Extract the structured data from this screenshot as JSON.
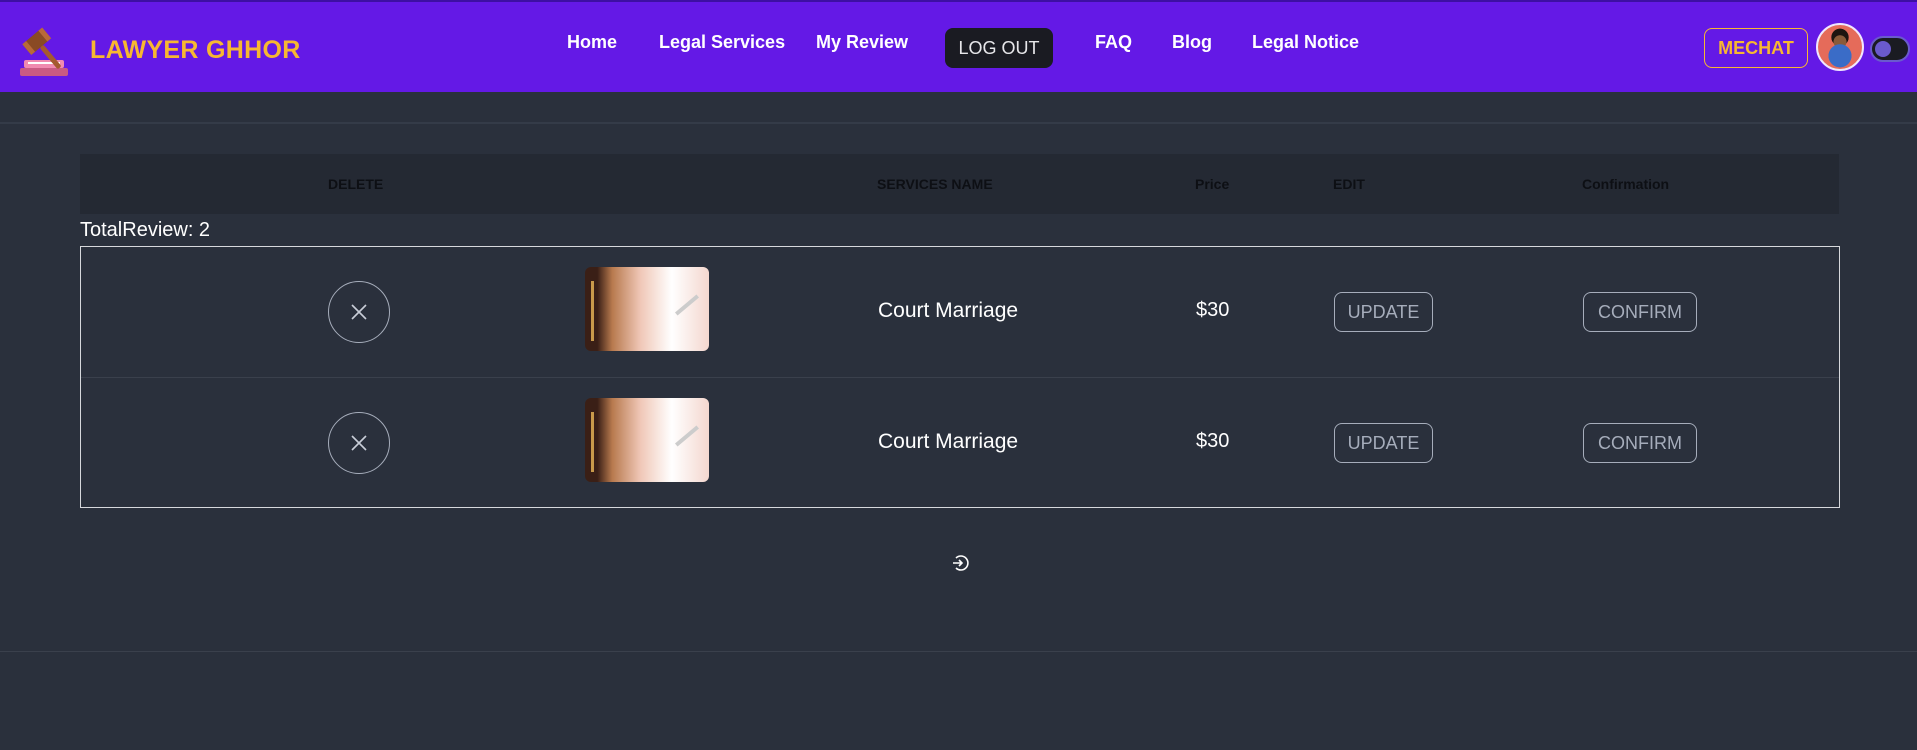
{
  "brand": {
    "name": "LAWYER GHHOR",
    "logo_icon": "gavel-icon"
  },
  "nav": {
    "items": [
      {
        "label": "Home"
      },
      {
        "label": "Legal Services"
      },
      {
        "label": "My Review"
      },
      {
        "label": "FAQ"
      },
      {
        "label": "Blog"
      },
      {
        "label": "Legal Notice"
      }
    ],
    "logout_label": "LOG OUT"
  },
  "user": {
    "chat_label": "MECHAT"
  },
  "table": {
    "headers": {
      "delete": "DELETE",
      "service_name": "SERVICES NAME",
      "price": "Price",
      "edit": "EDIT",
      "confirmation": "Confirmation"
    },
    "total_label": "TotalReview: 2",
    "rows": [
      {
        "service": "Court Marriage",
        "price": "$30",
        "update_label": "UPDATE",
        "confirm_label": "CONFIRM"
      },
      {
        "service": "Court Marriage",
        "price": "$30",
        "update_label": "UPDATE",
        "confirm_label": "CONFIRM"
      }
    ]
  },
  "colors": {
    "navbar": "#6419e6",
    "brand_text": "#f7b731",
    "page_bg": "#2a303c",
    "logout_bg": "#1a1b22"
  },
  "footer": {
    "icon": "logout-circle-icon"
  }
}
